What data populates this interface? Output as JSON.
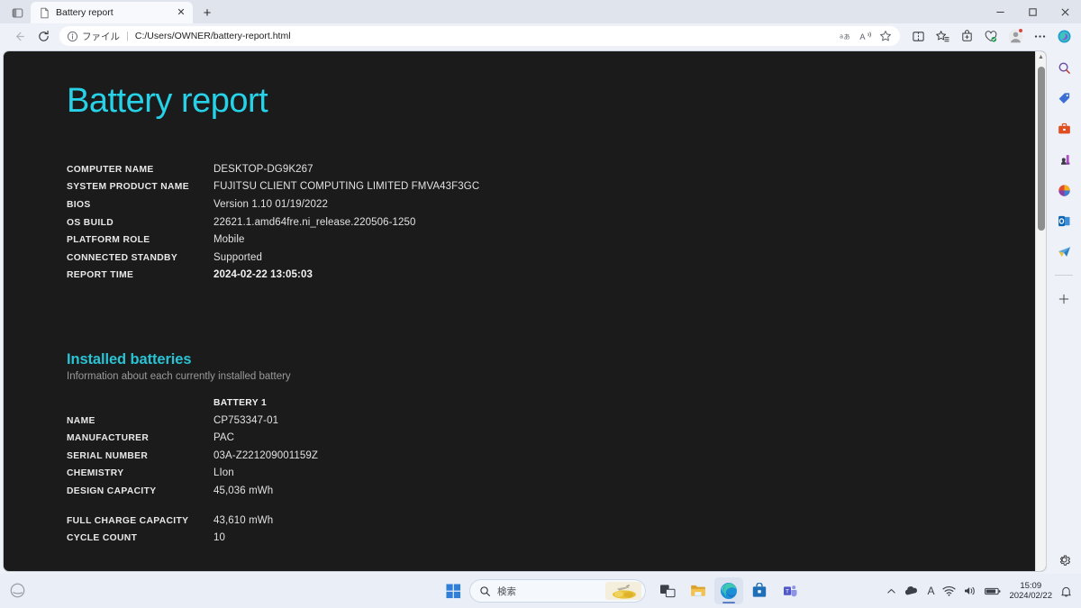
{
  "browser": {
    "tab": {
      "title": "Battery report",
      "favicon_icon": "document-icon",
      "close_icon": "close-icon"
    },
    "tab_search_icon": "tab-search-icon",
    "new_tab_icon": "plus-icon",
    "window_controls": {
      "minimize": "minimize-icon",
      "maximize": "maximize-icon",
      "close": "close-icon"
    },
    "nav": {
      "back_icon": "back-arrow-icon",
      "refresh_icon": "refresh-icon",
      "info_icon": "info-circle-icon",
      "scheme_label": "ファイル",
      "separator": "|",
      "url": "C:/Users/OWNER/battery-report.html",
      "omnibox_actions": [
        "translate-icon",
        "read-aloud-icon",
        "favorite-star-icon"
      ],
      "toolbar_actions": [
        "split-screen-icon",
        "collections-icon",
        "browser-essentials-icon",
        "copilot-icon"
      ],
      "profile_icon": "avatar-icon",
      "more_icon": "ellipsis-icon",
      "copilot_icon": "copilot-icon"
    },
    "sidebar": {
      "items": [
        {
          "name": "search-icon"
        },
        {
          "name": "shopping-tag-icon"
        },
        {
          "name": "tools-briefcase-icon"
        },
        {
          "name": "games-icon"
        },
        {
          "name": "microsoft365-icon"
        },
        {
          "name": "outlook-icon"
        },
        {
          "name": "paper-plane-icon"
        }
      ],
      "add_icon": "plus-icon",
      "settings_icon": "gear-icon"
    },
    "scrollbar": {
      "up_arrow": "▲",
      "down_arrow": "▼"
    }
  },
  "report": {
    "title": "Battery report",
    "accent_color": "#27d2e8",
    "section_accent_color": "#29c3d4",
    "background_color": "#1b1b1b",
    "system_info": [
      {
        "key": "COMPUTER NAME",
        "value": "DESKTOP-DG9K267",
        "bold": false
      },
      {
        "key": "SYSTEM PRODUCT NAME",
        "value": "FUJITSU CLIENT COMPUTING LIMITED FMVA43F3GC",
        "bold": false
      },
      {
        "key": "BIOS",
        "value": "Version 1.10 01/19/2022",
        "bold": false
      },
      {
        "key": "OS BUILD",
        "value": "22621.1.amd64fre.ni_release.220506-1250",
        "bold": false
      },
      {
        "key": "PLATFORM ROLE",
        "value": "Mobile",
        "bold": false
      },
      {
        "key": "CONNECTED STANDBY",
        "value": "Supported",
        "bold": false
      },
      {
        "key": "REPORT TIME",
        "value": "2024-02-22  13:05:03",
        "bold": true
      }
    ],
    "installed_batteries": {
      "heading": "Installed batteries",
      "subheading": "Information about each currently installed battery",
      "column_header": "BATTERY 1",
      "rows_group1": [
        {
          "key": "NAME",
          "value": "CP753347-01"
        },
        {
          "key": "MANUFACTURER",
          "value": "PAC"
        },
        {
          "key": "SERIAL NUMBER",
          "value": "03A-Z221209001159Z"
        },
        {
          "key": "CHEMISTRY",
          "value": "LIon"
        },
        {
          "key": "DESIGN CAPACITY",
          "value": "45,036 mWh"
        }
      ],
      "rows_group2": [
        {
          "key": "FULL CHARGE CAPACITY",
          "value": "43,610 mWh"
        },
        {
          "key": "CYCLE COUNT",
          "value": "10"
        }
      ]
    }
  },
  "taskbar": {
    "start_icon": "windows-start-icon",
    "search": {
      "placeholder": "検索",
      "icon": "search-icon",
      "widget_icon": "food-thumbnail-icon"
    },
    "buttons": [
      {
        "name": "task-view-icon",
        "active": false
      },
      {
        "name": "file-explorer-icon",
        "active": false
      },
      {
        "name": "microsoft-edge-icon",
        "active": true
      },
      {
        "name": "microsoft-store-icon",
        "active": false
      },
      {
        "name": "microsoft-teams-icon",
        "active": false
      }
    ],
    "tray": {
      "overflow_icon": "chevron-up-icon",
      "cloud_icon": "cloud-icon",
      "ime_label": "A",
      "wifi_icon": "wifi-icon",
      "volume_icon": "speaker-icon",
      "battery_icon": "battery-icon",
      "time": "15:09",
      "date": "2024/02/22",
      "notification_icon": "bell-icon"
    }
  }
}
